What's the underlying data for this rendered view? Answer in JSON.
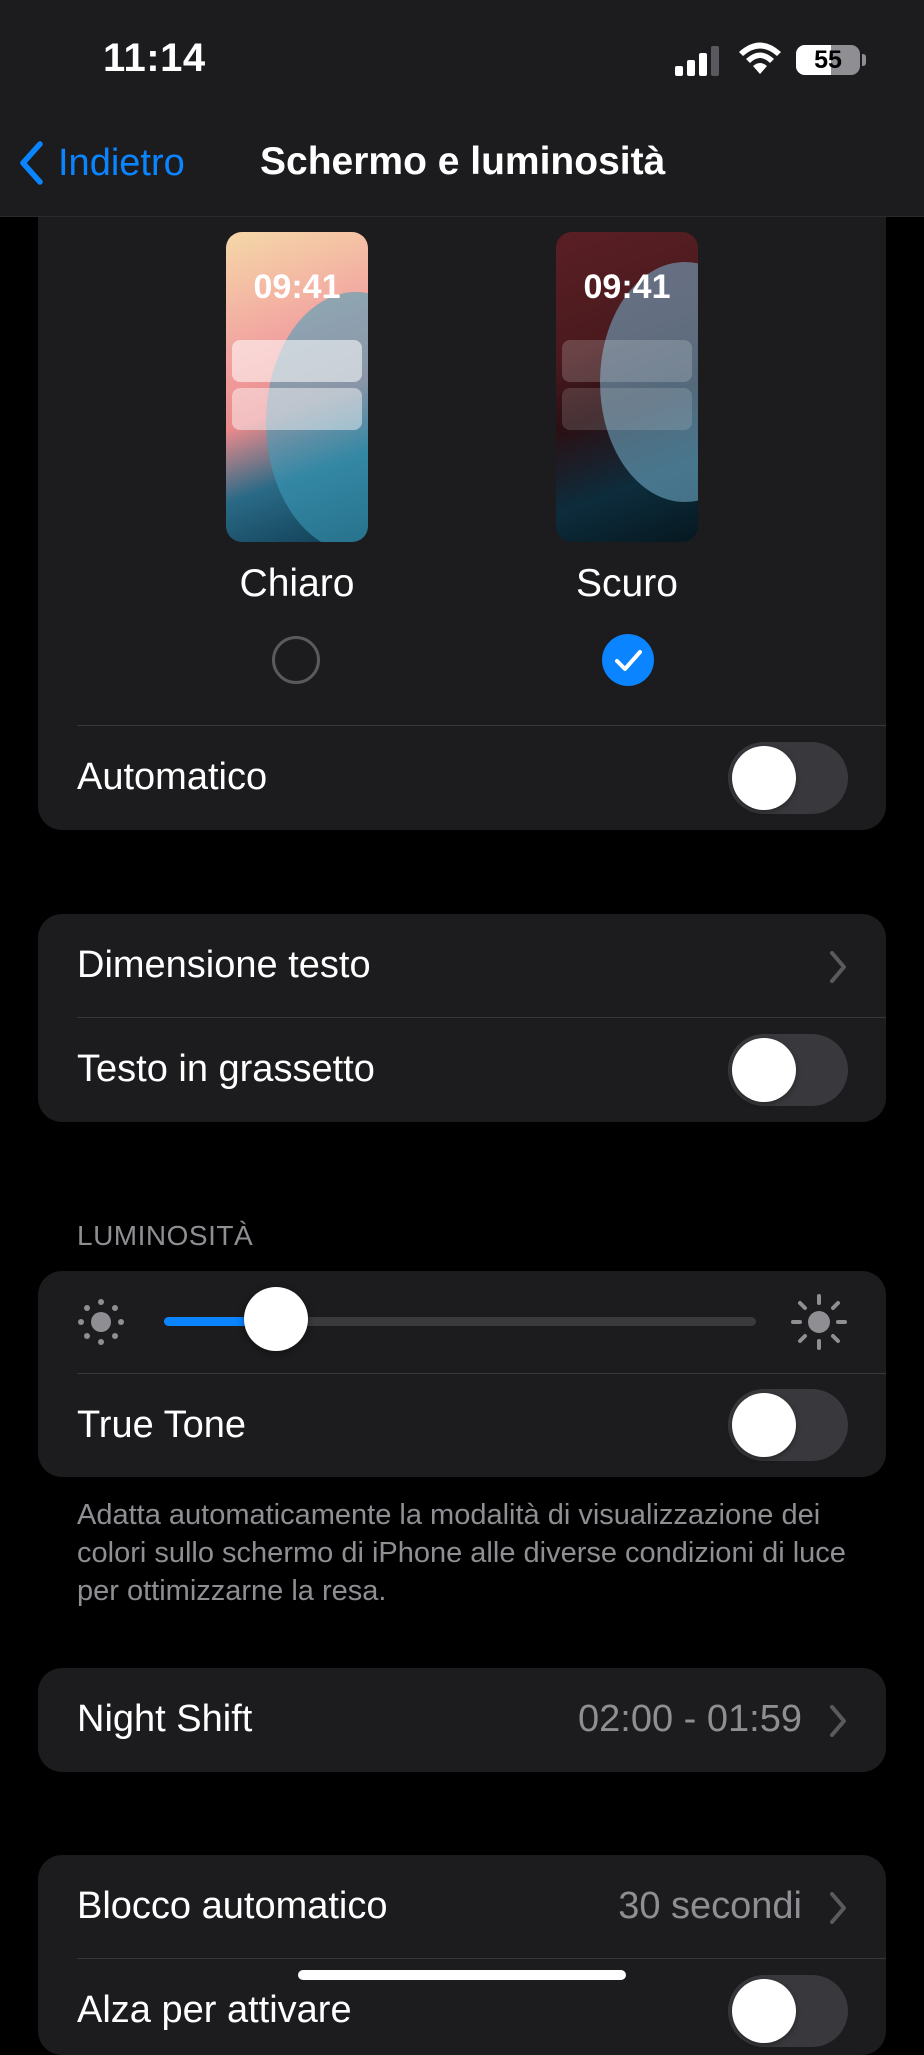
{
  "status_bar": {
    "time": "11:14",
    "battery_percent": "55",
    "battery_level": 55
  },
  "nav": {
    "back_label": "Indietro",
    "title": "Schermo e luminosità"
  },
  "appearance": {
    "light": {
      "label": "Chiaro",
      "preview_time": "09:41",
      "selected": false
    },
    "dark": {
      "label": "Scuro",
      "preview_time": "09:41",
      "selected": true
    },
    "automatic": {
      "label": "Automatico",
      "on": false
    }
  },
  "text_group": {
    "text_size_label": "Dimensione testo",
    "bold_text": {
      "label": "Testo in grassetto",
      "on": false
    }
  },
  "brightness": {
    "header": "LUMINOSITÀ",
    "level": 0.19,
    "true_tone": {
      "label": "True Tone",
      "on": false
    },
    "footnote": "Adatta automaticamente la modalità di visualizzazione dei colori sullo schermo di iPhone alle diverse condizioni di luce per ottimizzarne la resa."
  },
  "night_shift": {
    "label": "Night Shift",
    "value": "02:00 - 01:59"
  },
  "auto_lock": {
    "label": "Blocco automatico",
    "value": "30 secondi"
  },
  "next_row": {
    "label": "Alza per attivare"
  },
  "colors": {
    "accent": "#0a84ff",
    "card": "#1c1c1e",
    "background": "#000000",
    "secondary_text": "#8e8e93"
  }
}
